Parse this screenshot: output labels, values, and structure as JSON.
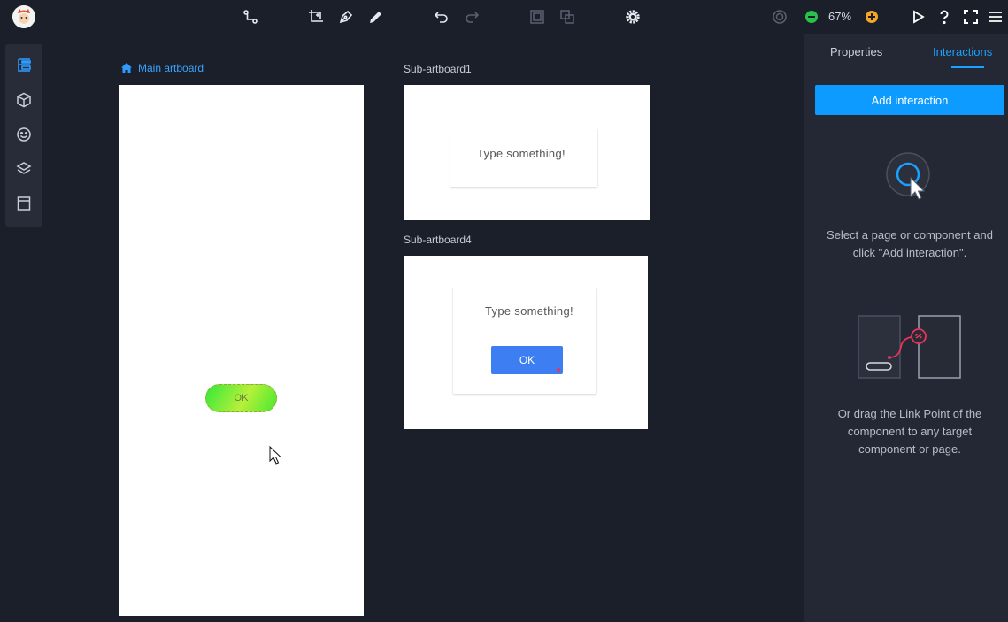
{
  "toolbar": {
    "zoom_level": "67%",
    "icons": [
      "avatar",
      "connect-icon",
      "crop-add-icon",
      "pen-icon",
      "pencil-icon",
      "undo-icon",
      "redo-icon",
      "group-icon",
      "ungroup-icon",
      "settings-icon",
      "target-icon",
      "zoom-out-icon",
      "zoom-in-icon",
      "play-icon",
      "help-icon",
      "fullscreen-icon",
      "menu-icon"
    ]
  },
  "left_rail": {
    "items": [
      "layers-tree-icon",
      "components-icon",
      "emoji-icon",
      "stack-icon",
      "page-icon"
    ]
  },
  "canvas": {
    "main_artboard": {
      "label": "Main artboard",
      "button_label": "OK"
    },
    "sub_artboard1": {
      "label": "Sub-artboard1",
      "dialog_text": "Type something!"
    },
    "sub_artboard4": {
      "label": "Sub-artboard4",
      "dialog_text": "Type something!",
      "button_label": "OK"
    }
  },
  "right_panel": {
    "tabs": [
      {
        "label": "Properties",
        "active": false
      },
      {
        "label": "Interactions",
        "active": true
      }
    ],
    "add_button": "Add interaction",
    "hint1": "Select a page or component and click \"Add interaction\".",
    "hint2": "Or drag the Link Point of the component to any target component or page."
  },
  "colors": {
    "accent": "#1aa1ff",
    "panel_bg": "#232834",
    "canvas_bg": "#1b1f29",
    "ok_blue": "#3d7ef2",
    "link_red": "#e8335a"
  }
}
